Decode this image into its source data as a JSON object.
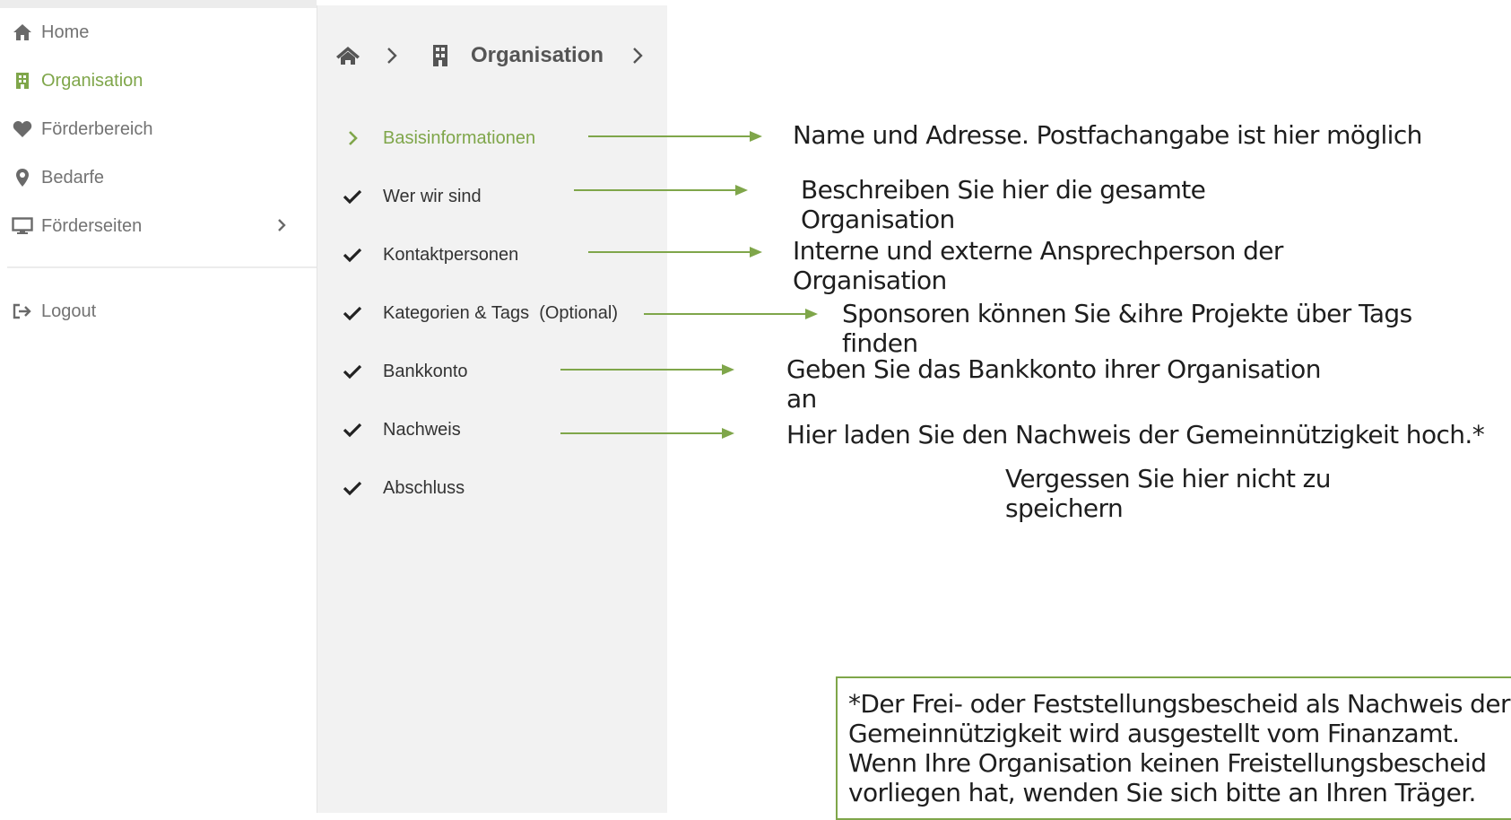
{
  "sidebar": {
    "items": [
      {
        "label": "Home",
        "icon": "home-icon"
      },
      {
        "label": "Organisation",
        "icon": "building-icon"
      },
      {
        "label": "Förderbereich",
        "icon": "heart-icon"
      },
      {
        "label": "Bedarfe",
        "icon": "map-pin-icon"
      },
      {
        "label": "Förderseiten",
        "icon": "monitor-icon"
      }
    ],
    "logout": {
      "label": "Logout",
      "icon": "logout-icon"
    }
  },
  "breadcrumb": {
    "title": "Organisation"
  },
  "steps": [
    {
      "label": "Basisinformationen",
      "status": "current"
    },
    {
      "label": "Wer wir sind",
      "status": "done"
    },
    {
      "label": "Kontaktpersonen",
      "status": "done"
    },
    {
      "label": "Kategorien & Tags  (Optional)",
      "status": "done"
    },
    {
      "label": "Bankkonto",
      "status": "done"
    },
    {
      "label": "Nachweis",
      "status": "done"
    },
    {
      "label": "Abschluss",
      "status": "done"
    }
  ],
  "notes": {
    "basis": "Name und Adresse. Postfachangabe ist hier möglich",
    "wer": "Beschreiben Sie hier die gesamte\nOrganisation",
    "kontakt": "Interne und externe Ansprechperson der\nOrganisation",
    "tags": "Sponsoren können Sie &ihre Projekte über Tags\nfinden",
    "bank": "Geben Sie das Bankkonto ihrer Organisation\nan",
    "nachweis": "Hier laden Sie den Nachweis der Gemeinnützigkeit hoch.*",
    "abschluss": "Vergessen Sie hier nicht zu\nspeichern"
  },
  "footnote": "*Der Frei- oder Feststellungsbescheid als Nachweis der\nGemeinnützigkeit wird ausgestellt vom Finanzamt.\nWenn Ihre Organisation keinen Freistellungsbescheid\nvorliegen hat, wenden Sie sich bitte an Ihren Träger.",
  "colors": {
    "accent": "#7fa64a",
    "muted": "#737373",
    "panel": "#f2f2f2"
  }
}
